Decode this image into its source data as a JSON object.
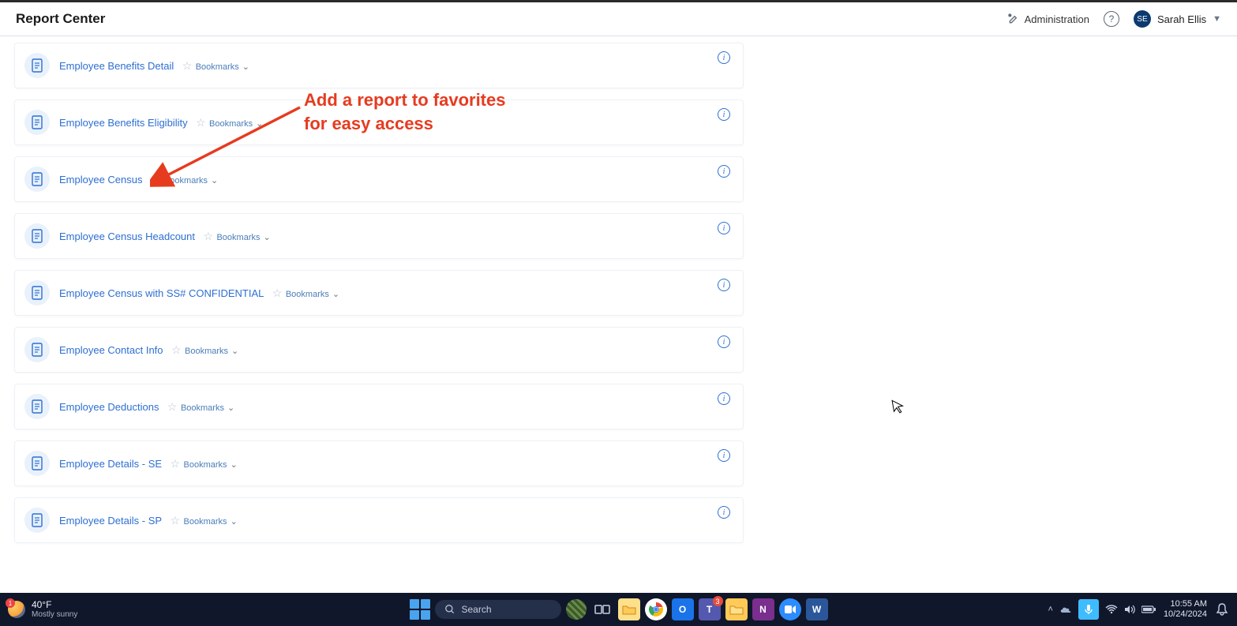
{
  "header": {
    "title": "Report Center",
    "admin_label": "Administration",
    "user_initials": "SE",
    "user_name": "Sarah Ellis"
  },
  "reports": [
    {
      "title": "Employee Benefits Detail",
      "bookmarks_label": "Bookmarks"
    },
    {
      "title": "Employee Benefits Eligibility",
      "bookmarks_label": "Bookmarks"
    },
    {
      "title": "Employee Census",
      "bookmarks_label": "Bookmarks"
    },
    {
      "title": "Employee Census Headcount",
      "bookmarks_label": "Bookmarks"
    },
    {
      "title": "Employee Census with SS# CONFIDENTIAL",
      "bookmarks_label": "Bookmarks"
    },
    {
      "title": "Employee Contact Info",
      "bookmarks_label": "Bookmarks"
    },
    {
      "title": "Employee Deductions",
      "bookmarks_label": "Bookmarks"
    },
    {
      "title": "Employee Details - SE",
      "bookmarks_label": "Bookmarks"
    },
    {
      "title": "Employee Details - SP",
      "bookmarks_label": "Bookmarks"
    }
  ],
  "annotation": {
    "line1": "Add a report to favorites",
    "line2": "for easy access"
  },
  "taskbar": {
    "weather_badge": "1",
    "temp": "40°F",
    "condition": "Mostly sunny",
    "search_placeholder": "Search",
    "teams_badge": "3",
    "time": "10:55 AM",
    "date": "10/24/2024"
  }
}
